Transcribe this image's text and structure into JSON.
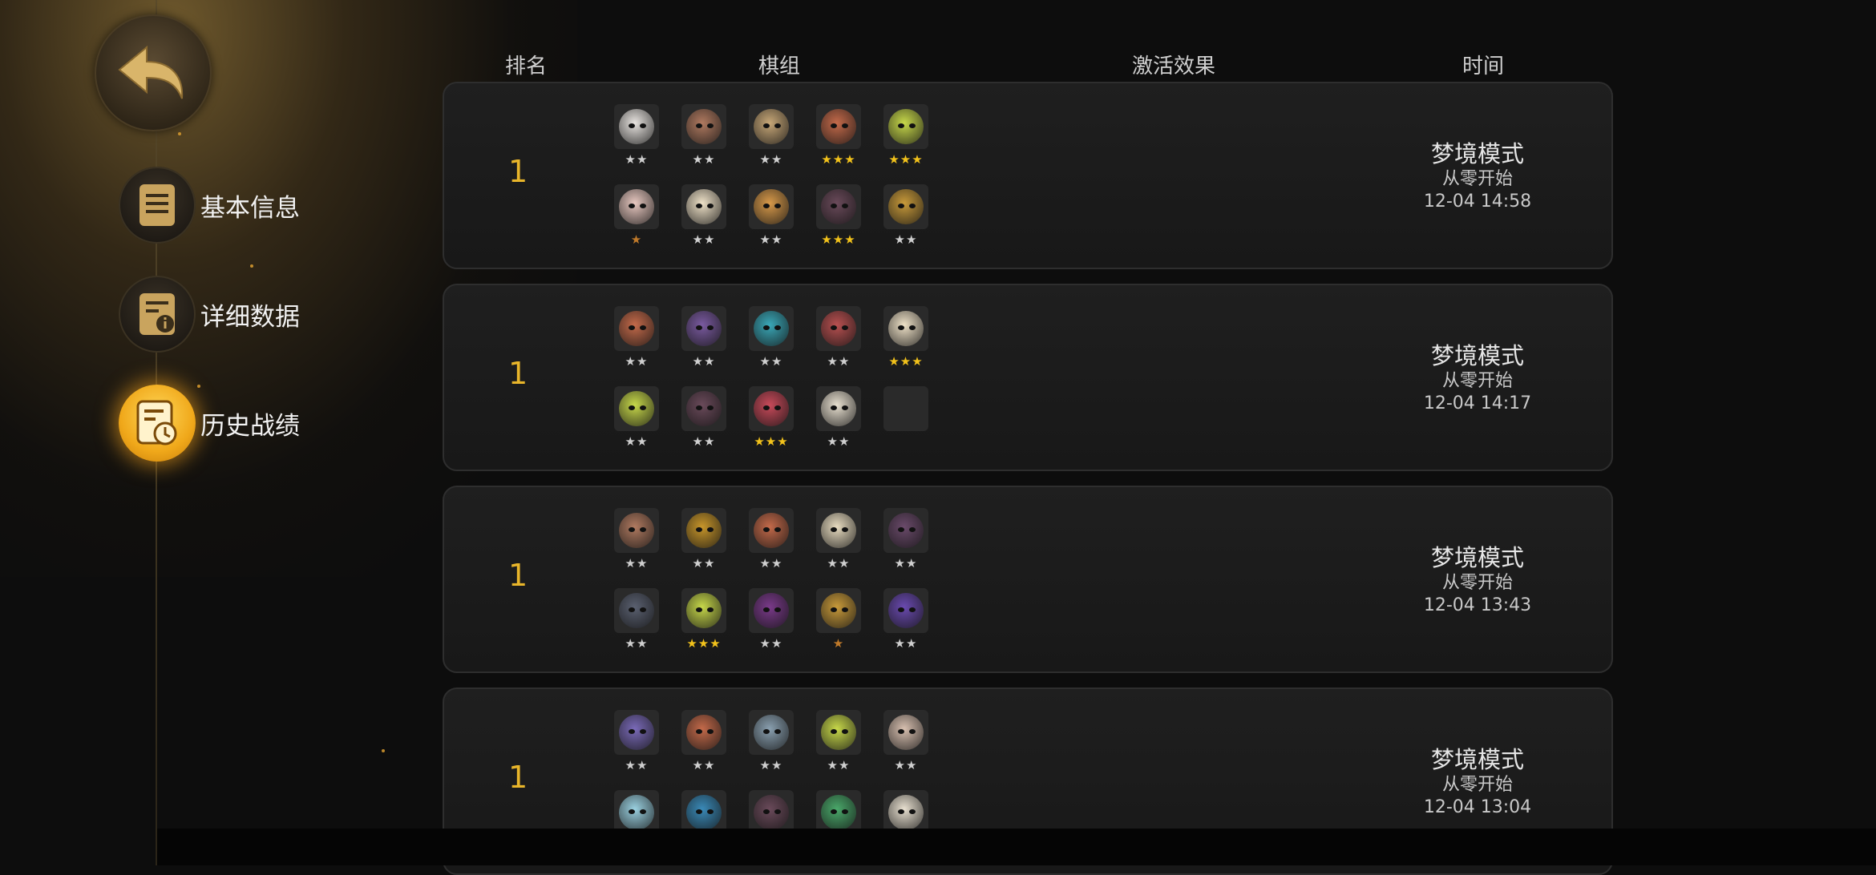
{
  "sidebar": {
    "items": [
      {
        "label": "基本信息",
        "icon": "document-icon",
        "active": false
      },
      {
        "label": "详细数据",
        "icon": "document-info-icon",
        "active": false
      },
      {
        "label": "历史战绩",
        "icon": "history-clock-icon",
        "active": true
      }
    ]
  },
  "table": {
    "headers": {
      "rank": "排名",
      "lineup": "棋组",
      "effects": "激活效果",
      "time": "时间"
    },
    "rows": [
      {
        "rank": "1",
        "mode": "梦境模式",
        "sub": "从零开始",
        "time": "12-04 14:58",
        "pieces": [
          {
            "color": "#e8e4e0",
            "stars": "★★",
            "star_color": "#cfcfcf"
          },
          {
            "color": "#b07a60",
            "stars": "★★",
            "star_color": "#cfcfcf"
          },
          {
            "color": "#c8a878",
            "stars": "★★",
            "star_color": "#cfcfcf"
          },
          {
            "color": "#c46a4a",
            "stars": "★★★",
            "star_color": "#f2c21b"
          },
          {
            "color": "#c7d84a",
            "stars": "★★★",
            "star_color": "#f2c21b"
          },
          {
            "color": "#e8c8c0",
            "stars": "★",
            "star_color": "#c07a2a"
          },
          {
            "color": "#efe2c8",
            "stars": "★★",
            "star_color": "#cfcfcf"
          },
          {
            "color": "#d89a4a",
            "stars": "★★",
            "star_color": "#cfcfcf"
          },
          {
            "color": "#6a4a5a",
            "stars": "★★★",
            "star_color": "#f2c21b"
          },
          {
            "color": "#c89a3a",
            "stars": "★★",
            "star_color": "#cfcfcf"
          }
        ]
      },
      {
        "rank": "1",
        "mode": "梦境模式",
        "sub": "从零开始",
        "time": "12-04 14:17",
        "pieces": [
          {
            "color": "#c46a4a",
            "stars": "★★",
            "star_color": "#cfcfcf"
          },
          {
            "color": "#7a5aa0",
            "stars": "★★",
            "star_color": "#cfcfcf"
          },
          {
            "color": "#3aa8b8",
            "stars": "★★",
            "star_color": "#cfcfcf"
          },
          {
            "color": "#b85050",
            "stars": "★★",
            "star_color": "#cfcfcf"
          },
          {
            "color": "#efe2c8",
            "stars": "★★★",
            "star_color": "#f2c21b"
          },
          {
            "color": "#c7d84a",
            "stars": "★★",
            "star_color": "#cfcfcf"
          },
          {
            "color": "#6a4a5a",
            "stars": "★★",
            "star_color": "#cfcfcf"
          },
          {
            "color": "#c84a5a",
            "stars": "★★★",
            "star_color": "#f2c21b"
          },
          {
            "color": "#e8e0d0",
            "stars": "★★",
            "star_color": "#cfcfcf"
          },
          {
            "color": "#2e2e2e",
            "stars": "",
            "star_color": "#cfcfcf"
          }
        ]
      },
      {
        "rank": "1",
        "mode": "梦境模式",
        "sub": "从零开始",
        "time": "12-04 13:43",
        "pieces": [
          {
            "color": "#b07a60",
            "stars": "★★",
            "star_color": "#cfcfcf"
          },
          {
            "color": "#c8962a",
            "stars": "★★",
            "star_color": "#cfcfcf"
          },
          {
            "color": "#c46a4a",
            "stars": "★★",
            "star_color": "#cfcfcf"
          },
          {
            "color": "#e8dcc0",
            "stars": "★★",
            "star_color": "#cfcfcf"
          },
          {
            "color": "#6a4a6a",
            "stars": "★★",
            "star_color": "#cfcfcf"
          },
          {
            "color": "#5a6070",
            "stars": "★★",
            "star_color": "#cfcfcf"
          },
          {
            "color": "#c7d84a",
            "stars": "★★★",
            "star_color": "#f2c21b"
          },
          {
            "color": "#7a3a8a",
            "stars": "★★",
            "star_color": "#cfcfcf"
          },
          {
            "color": "#c89a3a",
            "stars": "★",
            "star_color": "#c07a2a"
          },
          {
            "color": "#6a4ab0",
            "stars": "★★",
            "star_color": "#cfcfcf"
          }
        ]
      },
      {
        "rank": "1",
        "mode": "梦境模式",
        "sub": "从零开始",
        "time": "12-04 13:04",
        "pieces": [
          {
            "color": "#7a6ab8",
            "stars": "★★",
            "star_color": "#cfcfcf"
          },
          {
            "color": "#c46a4a",
            "stars": "★★",
            "star_color": "#cfcfcf"
          },
          {
            "color": "#8aa0b0",
            "stars": "★★",
            "star_color": "#cfcfcf"
          },
          {
            "color": "#c7d84a",
            "stars": "★★",
            "star_color": "#cfcfcf"
          },
          {
            "color": "#d8c0b0",
            "stars": "★★",
            "star_color": "#cfcfcf"
          },
          {
            "color": "#9ad0e0",
            "stars": "",
            "star_color": "#cfcfcf"
          },
          {
            "color": "#3a8ab8",
            "stars": "",
            "star_color": "#cfcfcf"
          },
          {
            "color": "#6a4a5a",
            "stars": "",
            "star_color": "#cfcfcf"
          },
          {
            "color": "#4aa86a",
            "stars": "",
            "star_color": "#cfcfcf"
          },
          {
            "color": "#e8e0d0",
            "stars": "",
            "star_color": "#cfcfcf"
          }
        ]
      }
    ]
  },
  "colors": {
    "accent": "#e8b52a",
    "active_glow": "#f0a81a"
  }
}
